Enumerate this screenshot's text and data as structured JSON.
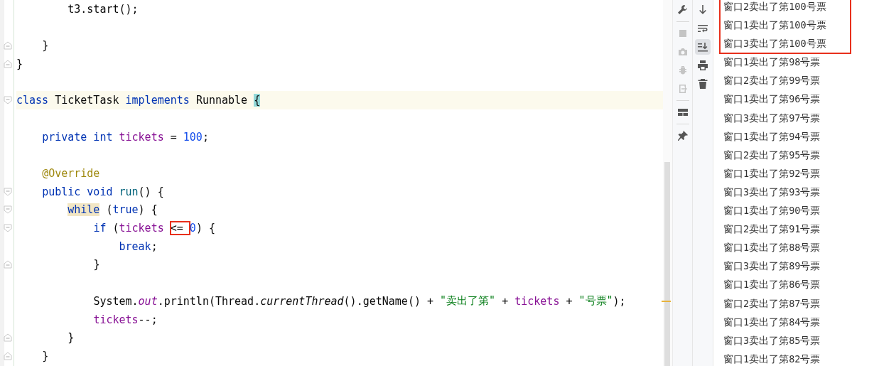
{
  "editor": {
    "lines": [
      {
        "kind": "plain",
        "current": false,
        "tokens": [
          {
            "t": "        t3.start();",
            "kind": "plain"
          }
        ]
      },
      {
        "kind": "plain",
        "current": false
      },
      {
        "kind": "fold-end",
        "current": false,
        "tokens": [
          {
            "t": "    }",
            "kind": "plain"
          }
        ]
      },
      {
        "kind": "fold-end",
        "current": false,
        "tokens": [
          {
            "t": "}",
            "kind": "plain"
          }
        ]
      },
      {
        "kind": "plain",
        "current": false
      },
      {
        "kind": "fold-start",
        "current": true,
        "tokens": [
          {
            "t": "class",
            "kind": "keyword"
          },
          {
            "t": " TicketTask ",
            "kind": "plain"
          },
          {
            "t": "implements",
            "kind": "keyword"
          },
          {
            "t": " Runnable ",
            "kind": "plain"
          },
          {
            "t": "{",
            "kind": "brace-match"
          }
        ]
      },
      {
        "kind": "plain",
        "current": false
      },
      {
        "kind": "plain",
        "current": false,
        "tokens": [
          {
            "t": "    private int ",
            "kind": "keyword"
          },
          {
            "t": "tickets",
            "kind": "field"
          },
          {
            "t": " = ",
            "kind": "plain"
          },
          {
            "t": "100",
            "kind": "number"
          },
          {
            "t": ";",
            "kind": "plain"
          }
        ]
      },
      {
        "kind": "plain",
        "current": false
      },
      {
        "kind": "plain",
        "current": false,
        "tokens": [
          {
            "t": "    @Override",
            "kind": "annotation"
          }
        ]
      },
      {
        "kind": "fold-start",
        "current": false,
        "tokens": [
          {
            "t": "    public void ",
            "kind": "keyword"
          },
          {
            "t": "run",
            "kind": "method"
          },
          {
            "t": "() {",
            "kind": "plain"
          }
        ]
      },
      {
        "kind": "fold-start",
        "current": false,
        "tokens": [
          {
            "t": "        while",
            "kind": "keyword-usage"
          },
          {
            "t": " (",
            "kind": "plain"
          },
          {
            "t": "true",
            "kind": "keyword"
          },
          {
            "t": ") {",
            "kind": "plain"
          }
        ]
      },
      {
        "kind": "fold-start",
        "current": false,
        "tokens": [
          {
            "t": "            if",
            "kind": "keyword"
          },
          {
            "t": " (",
            "kind": "plain"
          },
          {
            "t": "tickets",
            "kind": "field"
          },
          {
            "t": " <= ",
            "kind": "plain",
            "boxed": true
          },
          {
            "t": "0",
            "kind": "number"
          },
          {
            "t": ") {",
            "kind": "plain"
          }
        ]
      },
      {
        "kind": "plain",
        "current": false,
        "tokens": [
          {
            "t": "                break",
            "kind": "keyword"
          },
          {
            "t": ";",
            "kind": "plain"
          }
        ]
      },
      {
        "kind": "fold-end",
        "current": false,
        "tokens": [
          {
            "t": "            }",
            "kind": "plain"
          }
        ]
      },
      {
        "kind": "plain",
        "current": false
      },
      {
        "kind": "plain",
        "current": false,
        "tokens": [
          {
            "t": "            System.",
            "kind": "plain"
          },
          {
            "t": "out",
            "kind": "static"
          },
          {
            "t": ".println(Thread.",
            "kind": "plain"
          },
          {
            "t": "currentThread",
            "kind": "italic"
          },
          {
            "t": "().getName() + ",
            "kind": "plain"
          },
          {
            "t": "\"卖出了第\"",
            "kind": "string"
          },
          {
            "t": " + ",
            "kind": "plain"
          },
          {
            "t": "tickets",
            "kind": "field"
          },
          {
            "t": " + ",
            "kind": "plain"
          },
          {
            "t": "\"号票\"",
            "kind": "string"
          },
          {
            "t": ");",
            "kind": "plain"
          }
        ]
      },
      {
        "kind": "plain",
        "current": false,
        "tokens": [
          {
            "t": "            tickets",
            "kind": "field"
          },
          {
            "t": "--;",
            "kind": "plain"
          }
        ]
      },
      {
        "kind": "fold-end",
        "current": false,
        "tokens": [
          {
            "t": "        }",
            "kind": "plain"
          }
        ]
      },
      {
        "kind": "fold-end",
        "current": false,
        "tokens": [
          {
            "t": "    }",
            "kind": "plain"
          }
        ]
      }
    ]
  },
  "tools_left": [
    {
      "kind": "wrench",
      "disabled": false
    },
    {
      "kind": "stop",
      "disabled": true
    },
    {
      "kind": "camera",
      "disabled": true
    },
    {
      "kind": "bug",
      "disabled": true
    },
    {
      "kind": "exit",
      "disabled": true
    },
    {
      "kind": "layout",
      "disabled": false
    },
    {
      "kind": "pin",
      "disabled": false
    }
  ],
  "tools_right": [
    {
      "kind": "down",
      "selected": false
    },
    {
      "kind": "wrap",
      "selected": false
    },
    {
      "kind": "scroll-end",
      "selected": true
    },
    {
      "kind": "print",
      "selected": false
    },
    {
      "kind": "trash",
      "selected": false
    }
  ],
  "console": {
    "groups": [
      {
        "boxed": true,
        "lines": [
          "窗口2卖出了第100号票",
          "窗口1卖出了第100号票",
          "窗口3卖出了第100号票"
        ]
      },
      {
        "boxed": false,
        "lines": [
          "窗口1卖出了第98号票",
          "窗口2卖出了第99号票",
          "窗口1卖出了第96号票",
          "窗口3卖出了第97号票",
          "窗口1卖出了第94号票",
          "窗口2卖出了第95号票",
          "窗口1卖出了第92号票",
          "窗口3卖出了第93号票",
          "窗口1卖出了第90号票",
          "窗口2卖出了第91号票",
          "窗口1卖出了第88号票",
          "窗口3卖出了第89号票",
          "窗口1卖出了第86号票",
          "窗口2卖出了第87号票",
          "窗口1卖出了第84号票",
          "窗口3卖出了第85号票",
          "窗口1卖出了第82号票"
        ]
      }
    ]
  }
}
